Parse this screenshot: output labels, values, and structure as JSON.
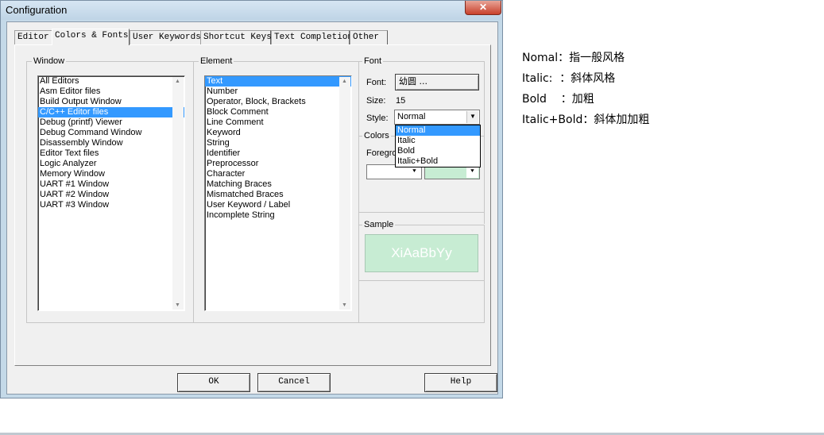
{
  "window": {
    "title": "Configuration",
    "close_glyph": "✕"
  },
  "tabs": [
    "Editor",
    "Colors & Fonts",
    "User Keywords",
    "Shortcut Keys",
    "Text Completion",
    "Other"
  ],
  "window_group": {
    "label": "Window",
    "items": [
      "All Editors",
      "Asm Editor files",
      "Build Output Window",
      "C/C++ Editor files",
      "Debug (printf) Viewer",
      "Debug Command Window",
      "Disassembly Window",
      "Editor Text files",
      "Logic Analyzer",
      "Memory Window",
      "UART #1 Window",
      "UART #2 Window",
      "UART #3 Window"
    ],
    "selected": "C/C++ Editor files"
  },
  "element_group": {
    "label": "Element",
    "items": [
      "Text",
      "Number",
      "Operator, Block, Brackets",
      "Block Comment",
      "Line Comment",
      "Keyword",
      "String",
      "Identifier",
      "Preprocessor",
      "Character",
      "Matching Braces",
      "Mismatched Braces",
      "User Keyword / Label",
      "Incomplete String"
    ],
    "selected": "Text"
  },
  "font_group": {
    "label": "Font",
    "font_label": "Font:",
    "font_value": "幼圆 ...",
    "size_label": "Size:",
    "size_value": "15",
    "style_label": "Style:",
    "style_value": "Normal",
    "style_options": [
      "Normal",
      "Italic",
      "Bold",
      "Italic+Bold"
    ]
  },
  "colors_group": {
    "label": "Colors",
    "foreground_label": "Foregro",
    "foreground_color": "#ffffff",
    "background_color": "#c7ecd3"
  },
  "sample_group": {
    "label": "Sample",
    "text": "XiAaBbYy"
  },
  "buttons": {
    "ok": "OK",
    "cancel": "Cancel",
    "help": "Help"
  },
  "notes": [
    "Nomal：指一般风格",
    "Italic:  ：斜体风格",
    "Bold    ：加粗",
    "Italic+Bold：斜体加加粗"
  ]
}
